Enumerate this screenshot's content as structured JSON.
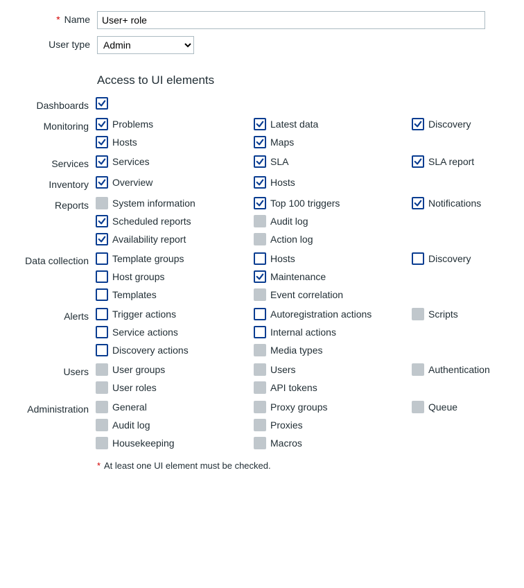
{
  "name_field": {
    "label": "Name",
    "value": "User+ role"
  },
  "user_type_field": {
    "label": "User type",
    "options": [
      "Admin"
    ],
    "selected": "Admin"
  },
  "section_heading": "Access to UI elements",
  "hint": "At least one UI element must be checked.",
  "sections": [
    {
      "id": "dashboards",
      "label": "Dashboards",
      "items": [
        {
          "id": "dashboards",
          "label": "",
          "checked": true,
          "enabled": true
        }
      ]
    },
    {
      "id": "monitoring",
      "label": "Monitoring",
      "items": [
        {
          "id": "problems",
          "label": "Problems",
          "checked": true,
          "enabled": true
        },
        {
          "id": "latest-data",
          "label": "Latest data",
          "checked": true,
          "enabled": true
        },
        {
          "id": "discovery",
          "label": "Discovery",
          "checked": true,
          "enabled": true
        },
        {
          "id": "hosts",
          "label": "Hosts",
          "checked": true,
          "enabled": true
        },
        {
          "id": "maps",
          "label": "Maps",
          "checked": true,
          "enabled": true
        }
      ]
    },
    {
      "id": "services",
      "label": "Services",
      "items": [
        {
          "id": "services",
          "label": "Services",
          "checked": true,
          "enabled": true
        },
        {
          "id": "sla",
          "label": "SLA",
          "checked": true,
          "enabled": true
        },
        {
          "id": "sla-report",
          "label": "SLA report",
          "checked": true,
          "enabled": true
        }
      ]
    },
    {
      "id": "inventory",
      "label": "Inventory",
      "items": [
        {
          "id": "overview",
          "label": "Overview",
          "checked": true,
          "enabled": true
        },
        {
          "id": "hosts",
          "label": "Hosts",
          "checked": true,
          "enabled": true
        }
      ]
    },
    {
      "id": "reports",
      "label": "Reports",
      "items": [
        {
          "id": "system-information",
          "label": "System information",
          "checked": false,
          "enabled": false
        },
        {
          "id": "top-100-triggers",
          "label": "Top 100 triggers",
          "checked": true,
          "enabled": true
        },
        {
          "id": "notifications",
          "label": "Notifications",
          "checked": true,
          "enabled": true
        },
        {
          "id": "scheduled-reports",
          "label": "Scheduled reports",
          "checked": true,
          "enabled": true
        },
        {
          "id": "audit-log",
          "label": "Audit log",
          "checked": false,
          "enabled": false
        },
        null,
        {
          "id": "availability-report",
          "label": "Availability report",
          "checked": true,
          "enabled": true
        },
        {
          "id": "action-log",
          "label": "Action log",
          "checked": false,
          "enabled": false
        }
      ]
    },
    {
      "id": "data-collection",
      "label": "Data collection",
      "items": [
        {
          "id": "template-groups",
          "label": "Template groups",
          "checked": false,
          "enabled": true
        },
        {
          "id": "hosts",
          "label": "Hosts",
          "checked": false,
          "enabled": true
        },
        {
          "id": "discovery",
          "label": "Discovery",
          "checked": false,
          "enabled": true
        },
        {
          "id": "host-groups",
          "label": "Host groups",
          "checked": false,
          "enabled": true
        },
        {
          "id": "maintenance",
          "label": "Maintenance",
          "checked": true,
          "enabled": true
        },
        null,
        {
          "id": "templates",
          "label": "Templates",
          "checked": false,
          "enabled": true
        },
        {
          "id": "event-correlation",
          "label": "Event correlation",
          "checked": false,
          "enabled": false
        }
      ]
    },
    {
      "id": "alerts",
      "label": "Alerts",
      "items": [
        {
          "id": "trigger-actions",
          "label": "Trigger actions",
          "checked": false,
          "enabled": true
        },
        {
          "id": "autoregistration-actions",
          "label": "Autoregistration actions",
          "checked": false,
          "enabled": true
        },
        {
          "id": "scripts",
          "label": "Scripts",
          "checked": false,
          "enabled": false
        },
        {
          "id": "service-actions",
          "label": "Service actions",
          "checked": false,
          "enabled": true
        },
        {
          "id": "internal-actions",
          "label": "Internal actions",
          "checked": false,
          "enabled": true
        },
        null,
        {
          "id": "discovery-actions",
          "label": "Discovery actions",
          "checked": false,
          "enabled": true
        },
        {
          "id": "media-types",
          "label": "Media types",
          "checked": false,
          "enabled": false
        }
      ]
    },
    {
      "id": "users",
      "label": "Users",
      "items": [
        {
          "id": "user-groups",
          "label": "User groups",
          "checked": false,
          "enabled": false
        },
        {
          "id": "users",
          "label": "Users",
          "checked": false,
          "enabled": false
        },
        {
          "id": "authentication",
          "label": "Authentication",
          "checked": false,
          "enabled": false
        },
        {
          "id": "user-roles",
          "label": "User roles",
          "checked": false,
          "enabled": false
        },
        {
          "id": "api-tokens",
          "label": "API tokens",
          "checked": false,
          "enabled": false
        }
      ]
    },
    {
      "id": "administration",
      "label": "Administration",
      "items": [
        {
          "id": "general",
          "label": "General",
          "checked": false,
          "enabled": false
        },
        {
          "id": "proxy-groups",
          "label": "Proxy groups",
          "checked": false,
          "enabled": false
        },
        {
          "id": "queue",
          "label": "Queue",
          "checked": false,
          "enabled": false
        },
        {
          "id": "audit-log",
          "label": "Audit log",
          "checked": false,
          "enabled": false
        },
        {
          "id": "proxies",
          "label": "Proxies",
          "checked": false,
          "enabled": false
        },
        null,
        {
          "id": "housekeeping",
          "label": "Housekeeping",
          "checked": false,
          "enabled": false
        },
        {
          "id": "macros",
          "label": "Macros",
          "checked": false,
          "enabled": false
        }
      ]
    }
  ]
}
